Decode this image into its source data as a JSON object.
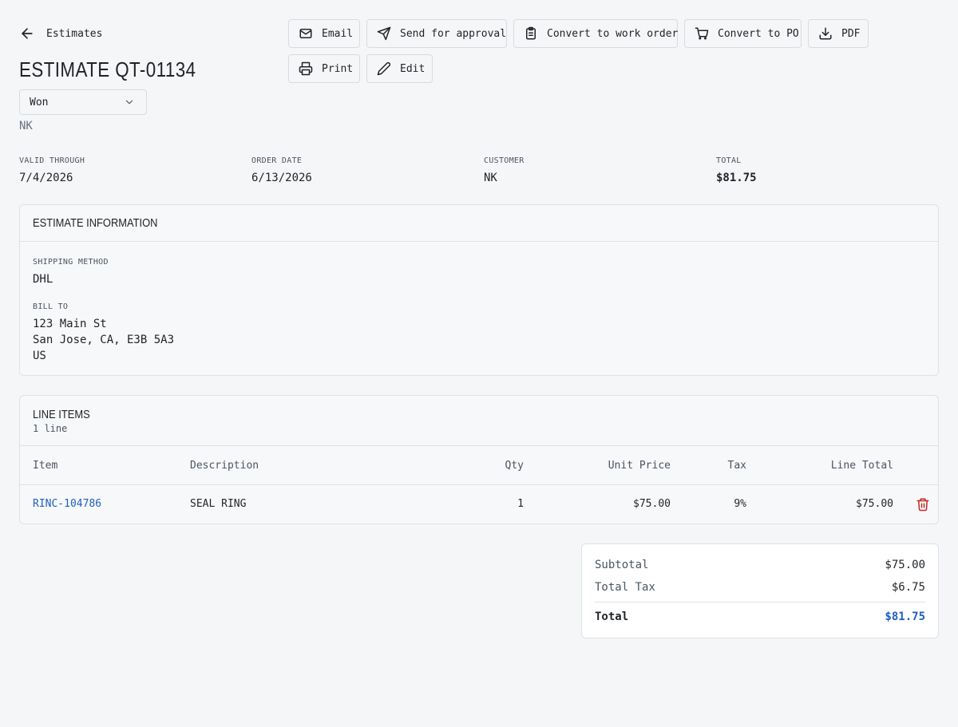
{
  "back": {
    "label": "Estimates"
  },
  "title": "ESTIMATE QT-01134",
  "status": {
    "selected": "Won"
  },
  "customer_initials": "NK",
  "toolbar": {
    "email": "Email",
    "send_for_approval": "Send for approval",
    "convert_to_work_order": "Convert to work order",
    "convert_to_po": "Convert to PO",
    "pdf": "PDF",
    "print": "Print",
    "edit": "Edit"
  },
  "summary": {
    "valid_through": {
      "label": "VALID THROUGH",
      "value": "7/4/2026"
    },
    "order_date": {
      "label": "ORDER DATE",
      "value": "6/13/2026"
    },
    "customer": {
      "label": "CUSTOMER",
      "value": "NK"
    },
    "total": {
      "label": "TOTAL",
      "value": "$81.75"
    }
  },
  "estimate_info": {
    "title": "ESTIMATE INFORMATION",
    "shipping_method": {
      "label": "SHIPPING METHOD",
      "value": "DHL"
    },
    "bill_to": {
      "label": "BILL TO",
      "line1": "123 Main St",
      "line2": "San Jose, CA, E3B 5A3",
      "line3": "US"
    }
  },
  "line_items": {
    "title": "LINE ITEMS",
    "count": "1 line",
    "columns": {
      "item": "Item",
      "description": "Description",
      "qty": "Qty",
      "unit_price": "Unit Price",
      "tax": "Tax",
      "line_total": "Line Total"
    },
    "rows": [
      {
        "item": "RINC-104786",
        "description": "SEAL RING",
        "qty": "1",
        "unit_price": "$75.00",
        "tax": "9%",
        "line_total": "$75.00"
      }
    ]
  },
  "totals": {
    "subtotal": {
      "label": "Subtotal",
      "value": "$75.00"
    },
    "total_tax": {
      "label": "Total Tax",
      "value": "$6.75"
    },
    "total": {
      "label": "Total",
      "value": "$81.75"
    }
  },
  "colors": {
    "accent": "#1f5fbf",
    "danger": "#c62828",
    "background": "#f5f6f8"
  },
  "icons": [
    "arrow-left-icon",
    "mail-icon",
    "send-icon",
    "clipboard-icon",
    "cart-icon",
    "download-icon",
    "printer-icon",
    "pencil-icon",
    "chevron-down-icon",
    "trash-icon"
  ]
}
